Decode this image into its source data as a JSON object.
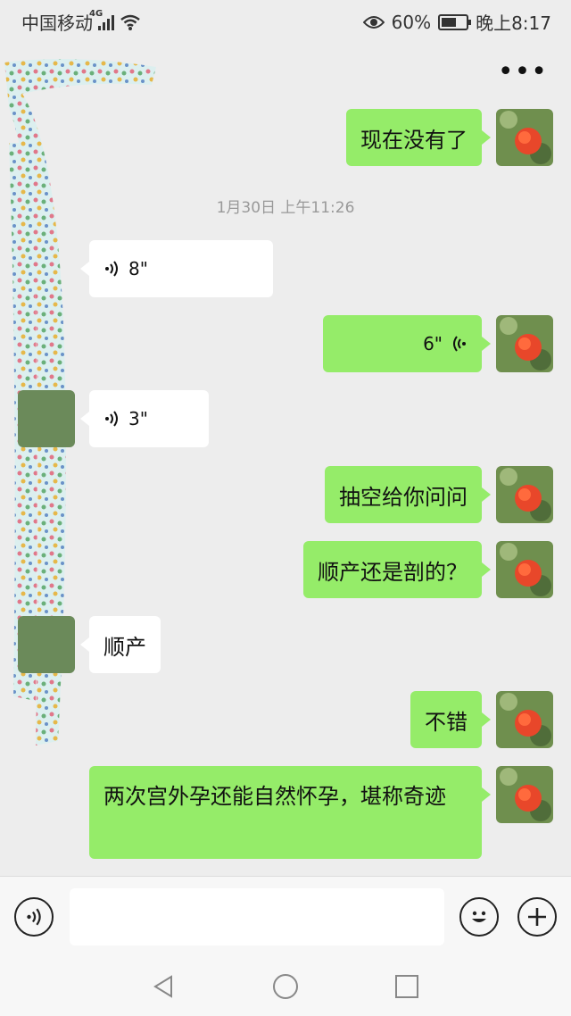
{
  "status_bar": {
    "carrier": "中国移动",
    "network": "4G",
    "battery": "60%",
    "battery_level": 0.6,
    "time": "晚上8:17"
  },
  "header": {
    "more_icon": "more-dots-icon"
  },
  "messages": [
    {
      "side": "right",
      "type": "text",
      "text": "现在没有了"
    },
    {
      "type": "timestamp",
      "text": "1月30日 上午11:26"
    },
    {
      "side": "left",
      "type": "voice",
      "text": "8\""
    },
    {
      "side": "right",
      "type": "voice",
      "text": "6\""
    },
    {
      "side": "left",
      "type": "voice",
      "text": "3\""
    },
    {
      "side": "right",
      "type": "text",
      "text": "抽空给你问问"
    },
    {
      "side": "right",
      "type": "text",
      "text": "顺产还是剖的？"
    },
    {
      "side": "left",
      "type": "text",
      "text": "顺产"
    },
    {
      "side": "right",
      "type": "text",
      "text": "不错"
    },
    {
      "side": "right",
      "type": "text",
      "text": "两次宫外孕还能自然怀孕，堪称奇迹"
    }
  ],
  "input_bar": {
    "voice_icon": "voice-mode-icon",
    "emoji_icon": "emoji-icon",
    "plus_icon": "plus-icon",
    "value": ""
  },
  "nav_bar": {
    "back_icon": "back-triangle-icon",
    "home_icon": "home-circle-icon",
    "recent_icon": "recent-square-icon"
  },
  "colors": {
    "background": "#ededed",
    "sent_bubble": "#95ec69",
    "received_bubble": "#ffffff"
  }
}
